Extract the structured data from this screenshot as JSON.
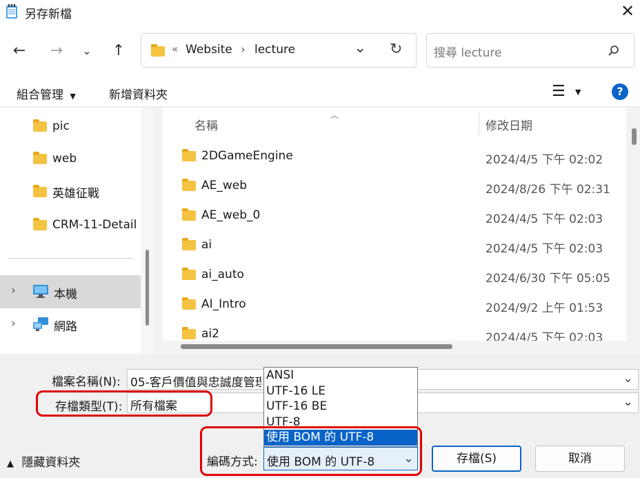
{
  "window": {
    "title": "另存新檔"
  },
  "address": {
    "prefix": "«",
    "crumbs": [
      "Website",
      "lecture"
    ]
  },
  "search": {
    "placeholder": "搜尋 lecture"
  },
  "toolbar": {
    "organize_label": "組合管理",
    "new_folder_label": "新增資料夾"
  },
  "sidebar": {
    "folders": [
      "pic",
      "web",
      "英雄征戰",
      "CRM-11-Detail"
    ],
    "this_pc_label": "本機",
    "network_label": "網路"
  },
  "filelist": {
    "col_name": "名稱",
    "col_date": "修改日期",
    "rows": [
      {
        "name": "2DGameEngine",
        "date": "2024/4/5 下午 02:02"
      },
      {
        "name": "AE_web",
        "date": "2024/8/26 下午 02:31"
      },
      {
        "name": "AE_web_0",
        "date": "2024/4/5 下午 02:03"
      },
      {
        "name": "ai",
        "date": "2024/4/5 下午 02:03"
      },
      {
        "name": "ai_auto",
        "date": "2024/6/30 下午 05:05"
      },
      {
        "name": "AI_Intro",
        "date": "2024/9/2 上午 01:53"
      },
      {
        "name": "ai2",
        "date": "2024/4/5 下午 02:03"
      }
    ]
  },
  "form": {
    "filename_label": "檔案名稱(N):",
    "filename_value": "05-客戶價值與忠誠度管理",
    "filetype_label": "存檔類型(T):",
    "filetype_value": "所有檔案",
    "encoding_label": "編碼方式:",
    "encoding_value": "使用 BOM 的 UTF-8",
    "encoding_options": [
      "ANSI",
      "UTF-16 LE",
      "UTF-16 BE",
      "UTF-8",
      "使用 BOM 的 UTF-8"
    ],
    "encoding_selected_index": 4
  },
  "footer": {
    "hide_folders_label": "隱藏資料夾",
    "save_label": "存檔(S)",
    "cancel_label": "取消"
  },
  "colors": {
    "accent": "#0a64c8",
    "highlight_box": "#e00000",
    "folder": "#f5c342"
  }
}
